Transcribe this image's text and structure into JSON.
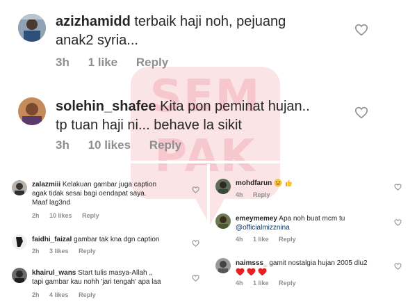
{
  "top_comments": [
    {
      "username": "azizhamidd",
      "text_line1": "terbaik haji noh, pejuang",
      "text_line2": "anak2 syria...",
      "time": "3h",
      "likes": "1 like",
      "reply": "Reply"
    },
    {
      "username": "solehin_shafee",
      "text_line1": "Kita pon peminat hujan..",
      "text_line2": "tp tuan haji ni... behave la sikit",
      "time": "3h",
      "likes": "10 likes",
      "reply": "Reply"
    }
  ],
  "left_comments": [
    {
      "username": "zalazmiii",
      "text_line1": "Kelakuan gambar juga caption",
      "text_line2": "agak tidak sesai bagi oendapat saya.",
      "text_line3": "Maaf lag3nd",
      "time": "2h",
      "likes": "10 likes",
      "reply": "Reply"
    },
    {
      "username": "faidhi_faizal",
      "text_line1": "gambar tak kna dgn caption",
      "time": "2h",
      "likes": "3 likes",
      "reply": "Reply"
    },
    {
      "username": "khairul_wans",
      "text_line1": "Start tulis masya-Allah ,,",
      "text_line2": "tapi gambar kau nohh 'jari tengah' apa laa",
      "time": "2h",
      "likes": "4 likes",
      "reply": "Reply"
    }
  ],
  "right_comments": [
    {
      "username": "mohdfarun",
      "text_line1": "",
      "time": "4h",
      "reply": "Reply"
    },
    {
      "username": "emeymemey",
      "text_line1": "Apa noh buat mcm tu",
      "mention": "@officialmizznina",
      "time": "4h",
      "likes": "1 like",
      "reply": "Reply"
    },
    {
      "username": "naimsss_",
      "text_line1": "gamit nostalgia hujan 2005 dlu2",
      "time": "4h",
      "likes": "1 like",
      "reply": "Reply"
    }
  ],
  "watermark": {
    "line1": "SEM",
    "line2": "PAK"
  },
  "colors": {
    "heart_stroke": "#8e8e8e",
    "meta": "#8e8e8e",
    "mention": "#003569",
    "watermark": "#f6c7cc"
  },
  "icons": {
    "like": "heart-outline-icon",
    "emoji_heart": "red-heart-emoji"
  }
}
